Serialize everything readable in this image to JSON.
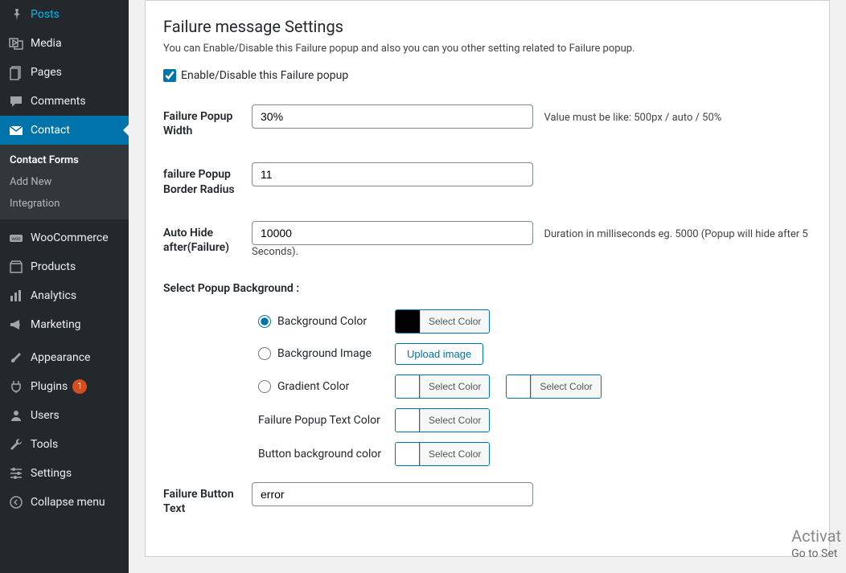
{
  "sidebar": {
    "items": [
      {
        "label": "Posts"
      },
      {
        "label": "Media"
      },
      {
        "label": "Pages"
      },
      {
        "label": "Comments"
      },
      {
        "label": "Contact"
      },
      {
        "label": "WooCommerce"
      },
      {
        "label": "Products"
      },
      {
        "label": "Analytics"
      },
      {
        "label": "Marketing"
      },
      {
        "label": "Appearance"
      },
      {
        "label": "Plugins"
      },
      {
        "label": "Users"
      },
      {
        "label": "Tools"
      },
      {
        "label": "Settings"
      },
      {
        "label": "Collapse menu"
      }
    ],
    "submenu": [
      {
        "label": "Contact Forms"
      },
      {
        "label": "Add New"
      },
      {
        "label": "Integration"
      }
    ],
    "plugins_badge": "1"
  },
  "main": {
    "heading": "Failure message Settings",
    "description": "You can Enable/Disable this Failure popup and also you can you other setting related to Failure popup.",
    "enable_label": "Enable/Disable this Failure popup",
    "enable_checked": true,
    "rows": {
      "width": {
        "label": "Failure Popup Width",
        "value": "30%",
        "help": "Value must be like: 500px / auto / 50%"
      },
      "radius": {
        "label": "failure Popup Border Radius",
        "value": "11"
      },
      "autohide": {
        "label": "Auto Hide after(Failure)",
        "value": "10000",
        "help": "Duration in milliseconds eg. 5000 (Popup will hide after 5 Seconds)."
      }
    },
    "bg_section": {
      "heading": "Select Popup Background :",
      "bg_color_label": "Background Color",
      "bg_image_label": "Background Image",
      "gradient_label": "Gradient Color",
      "text_color_label": "Failure Popup Text Color",
      "btn_bg_label": "Button background color",
      "select_color": "Select Color",
      "upload_image": "Upload image",
      "bg_swatch_color": "#000000"
    },
    "button_text": {
      "label": "Failure Button Text",
      "value": "error"
    }
  },
  "watermark": {
    "line1": "Activat",
    "line2": "Go to Set"
  }
}
